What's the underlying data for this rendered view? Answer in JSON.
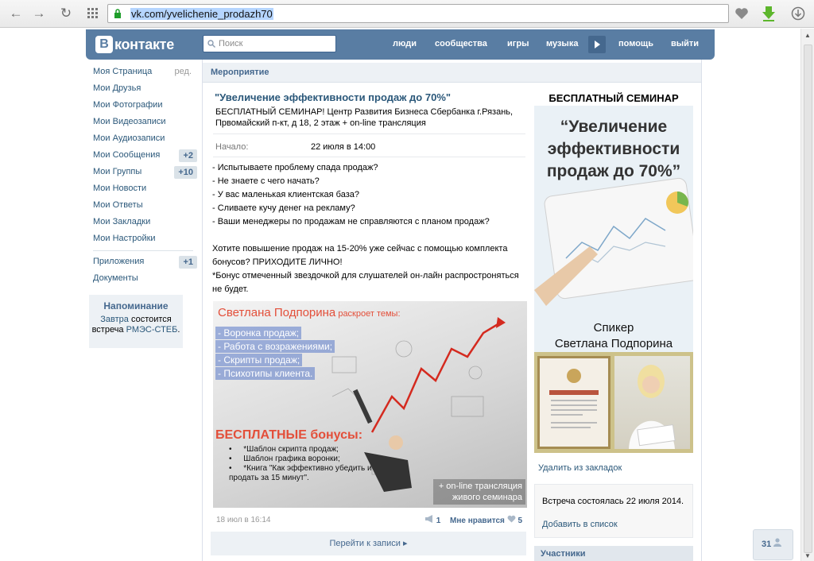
{
  "browser": {
    "url": "vk.com/yvelichenie_prodazh70"
  },
  "header": {
    "logo_text": "контакте",
    "logo_letter": "В",
    "search_placeholder": "Поиск",
    "nav": [
      "люди",
      "сообщества",
      "игры",
      "музыка",
      "помощь",
      "выйти"
    ]
  },
  "sidebar": {
    "items": [
      {
        "label": "Моя Страница",
        "extra": "ред."
      },
      {
        "label": "Мои Друзья"
      },
      {
        "label": "Мои Фотографии"
      },
      {
        "label": "Мои Видеозаписи"
      },
      {
        "label": "Мои Аудиозаписи"
      },
      {
        "label": "Мои Сообщения",
        "badge": "+2"
      },
      {
        "label": "Мои Группы",
        "badge": "+10"
      },
      {
        "label": "Мои Новости"
      },
      {
        "label": "Мои Ответы"
      },
      {
        "label": "Мои Закладки"
      },
      {
        "label": "Мои Настройки"
      }
    ],
    "items2": [
      {
        "label": "Приложения",
        "badge": "+1"
      },
      {
        "label": "Документы"
      }
    ],
    "reminder": {
      "title": "Напоминание",
      "line1_link": "Завтра",
      "line1_rest": " состоится",
      "line2_pre": "встреча ",
      "line2_link": "РМЭС-СТЕБ",
      "line2_post": "."
    }
  },
  "page": {
    "section_title": "Мероприятие",
    "event_title": "\"Увеличение эффективности продаж до 70%\"",
    "event_desc": "БЕСПЛАТНЫЙ СЕМИНАР! Центр Развития Бизнеса Сбербанка г.Рязань, Првомайский п-кт, д 18, 2 этаж + on-line трансляция",
    "start_label": "Начало:",
    "start_value": "22 июля в 14:00",
    "body_lines": [
      "- Испытываете проблему спада продаж?",
      "- Не знаете с чего начать?",
      "- У вас маленькая клиентская база?",
      "- Сливаете кучу денег на рекламу?",
      "- Ваши менеджеры по продажам не справляются с планом продаж?",
      "",
      "Хотите повышение продаж на 15-20% уже сейчас с помощью комплекта бонусов? ПРИХОДИТЕ ЛИЧНО!",
      "*Бонус отмеченный звездочкой для слушателей он-лайн распростроняться не будет."
    ],
    "poster": {
      "speaker": "Светлана Подпорина",
      "speaker_suffix": " раскроет темы:",
      "topics": [
        "- Воронка продаж;",
        "- Работа с возражениями;",
        "- Скрипты продаж;",
        "- Психотипы клиента."
      ],
      "bonus_title": "БЕСПЛАТНЫЕ бонусы:",
      "bonuses": [
        "*Шаблон скрипта продаж;",
        "Шаблон графика воронки;",
        "*Книга \"Как эффективно убедить и продать за 15 минут\"."
      ],
      "online": "+ on-line трансляция живого семинара"
    },
    "post_date": "18 июл в 16:14",
    "share_count": "1",
    "like_label": "Мне нравится",
    "like_count": "5",
    "go_to_post": "Перейти к записи"
  },
  "right": {
    "cover_top": "БЕСПЛАТНЫЙ СЕМИНАР",
    "cover_title": "“Увеличение эффективности продаж до 70%”",
    "cover_speaker_label": "Спикер",
    "cover_speaker_name": "Светлана Подпорина",
    "remove_bookmark": "Удалить из закладок",
    "meeting_status": "Встреча состоялась 22 июля 2014.",
    "add_to_list": "Добавить в список",
    "participants": "Участники"
  },
  "float_counter": "31",
  "colors": {
    "vk_header": "#597da3",
    "link": "#2b587a",
    "accent": "#45688e"
  }
}
